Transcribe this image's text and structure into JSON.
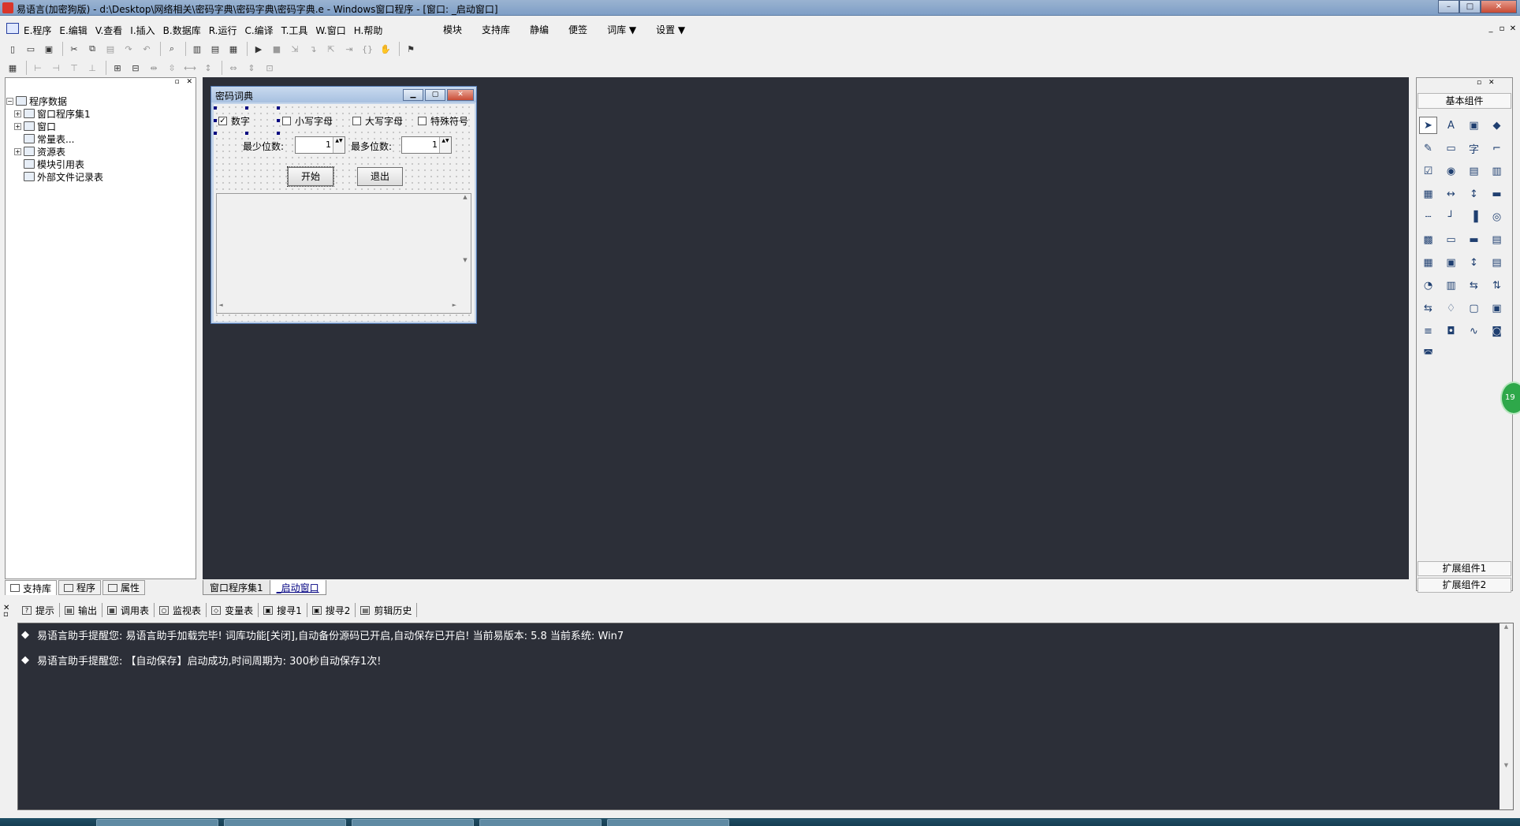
{
  "window": {
    "title": "易语言(加密狗版) - d:\\Desktop\\网络相关\\密码字典\\密码字典\\密码字典.e - Windows窗口程序 - [窗口: _启动窗口]",
    "minimize": "–",
    "maximize": "□",
    "close": "✕"
  },
  "menubar": {
    "items": [
      "E.程序",
      "E.编辑",
      "V.查看",
      "I.插入",
      "B.数据库",
      "R.运行",
      "C.编译",
      "T.工具",
      "W.窗口",
      "H.帮助"
    ],
    "extra": [
      "模块",
      "支持库",
      "静编",
      "便签",
      "词库 ▼",
      "设置 ▼"
    ]
  },
  "mdi_controls": [
    "_",
    "▫",
    "✕"
  ],
  "left_panel": {
    "header_buttons": "▫ ✕",
    "tree": [
      {
        "label": "程序数据",
        "expander": "−",
        "level": 0
      },
      {
        "label": "窗口程序集1",
        "expander": "+",
        "level": 1
      },
      {
        "label": "窗口",
        "expander": "+",
        "level": 1
      },
      {
        "label": "常量表...",
        "expander": "",
        "level": 1
      },
      {
        "label": "资源表",
        "expander": "+",
        "level": 1
      },
      {
        "label": "模块引用表",
        "expander": "",
        "level": 1
      },
      {
        "label": "外部文件记录表",
        "expander": "",
        "level": 1
      }
    ],
    "bottom_tabs": [
      "支持库",
      "程序",
      "属性"
    ]
  },
  "form": {
    "title": "密码词典",
    "checkboxes": [
      {
        "label": "数字",
        "checked": true,
        "mark": "✓"
      },
      {
        "label": "小写字母",
        "checked": false,
        "mark": ""
      },
      {
        "label": "大写字母",
        "checked": false,
        "mark": ""
      },
      {
        "label": "特殊符号",
        "checked": false,
        "mark": ""
      }
    ],
    "min_label": "最少位数:",
    "min_value": "1",
    "max_label": "最多位数:",
    "max_value": "1",
    "start_button": "开始",
    "exit_button": "退出"
  },
  "design_tabs": [
    "窗口程序集1",
    "_启动窗口"
  ],
  "palette": {
    "header_buttons": "▫ ✕",
    "title": "基本组件",
    "icons": [
      "pointer-icon",
      "label-icon",
      "picture-box-icon",
      "shape-icon",
      "edit-box-icon",
      "frame-icon",
      "text-icon",
      "line-icon",
      "checkbox-icon",
      "radio-icon",
      "combo-box-icon",
      "list-box-icon",
      "grid-icon",
      "scroll-horizontal-icon",
      "scroll-vertical-icon",
      "progress-icon",
      "ruler-icon",
      "slider-icon",
      "bar-icon",
      "timer-box-icon",
      "table-icon",
      "button-icon",
      "folder-icon",
      "document-icon",
      "calendar-icon",
      "data-source-icon",
      "splitter-icon",
      "calculator-icon",
      "clock-icon",
      "printer-icon",
      "network-icon",
      "server-icon",
      "client-icon",
      "connect-icon",
      "window-icon",
      "panel-icon",
      "tree-icon",
      "database-icon",
      "chart-icon",
      "odbc-icon",
      "odbc-db-icon"
    ],
    "glyphs": [
      "➤",
      "A",
      "▣",
      "◆",
      "✎",
      "▭",
      "字",
      "⌐",
      "☑",
      "◉",
      "▤",
      "▥",
      "▦",
      "↔",
      "↕",
      "▬",
      "┄",
      "┘",
      "▐",
      "◎",
      "▩",
      "▭",
      "▬",
      "▤",
      "▦",
      "▣",
      "↕",
      "▤",
      "◔",
      "▥",
      "⇆",
      "⇅",
      "⇆",
      "♢",
      "▢",
      "▣",
      "≡",
      "◘",
      "∿",
      "◙",
      "◚"
    ],
    "footer_1": "扩展组件1",
    "footer_2": "扩展组件2",
    "badge": "19"
  },
  "output_tabs": [
    "提示",
    "输出",
    "调用表",
    "监视表",
    "变量表",
    "搜寻1",
    "搜寻2",
    "剪辑历史"
  ],
  "output_tab_icons": [
    "?",
    "▤",
    "▦",
    "○",
    "◇",
    "▣",
    "▣",
    "▤"
  ],
  "output_lines": [
    "易语言助手提醒您:  易语言助手加载完毕!  词库功能[关闭],自动备份源码已开启,自动保存已开启!  当前易版本: 5.8  当前系统: Win7",
    "易语言助手提醒您: 【自动保存】启动成功,时间周期为: 300秒自动保存1次!"
  ],
  "colors": {
    "design_background": "#2c2f38",
    "title_bar": "#8fa9cc",
    "output_text": "#ffffff"
  }
}
